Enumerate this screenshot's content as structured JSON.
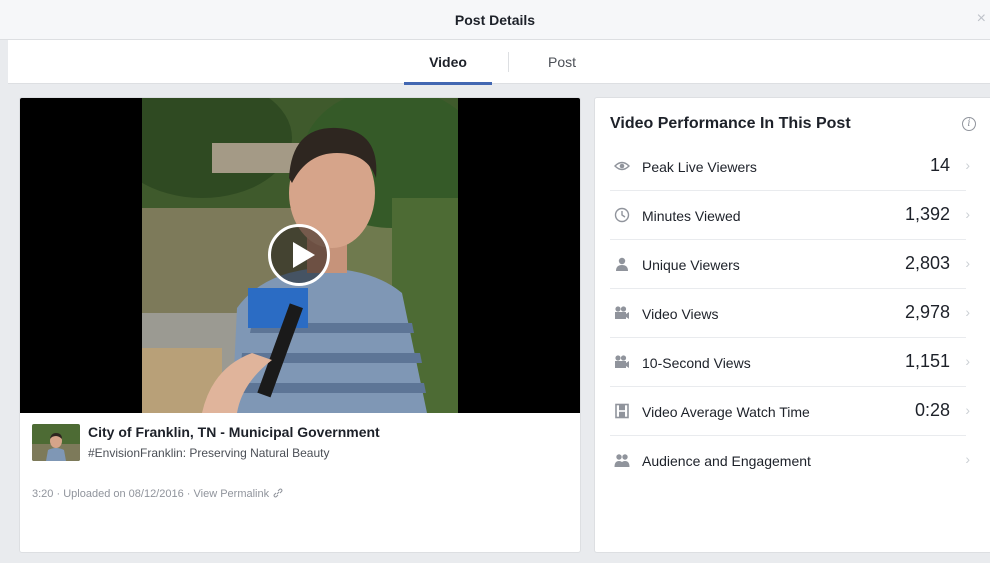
{
  "header": {
    "title": "Post Details",
    "close_label": "×"
  },
  "tabs": [
    {
      "label": "Video",
      "active": true
    },
    {
      "label": "Post",
      "active": false
    }
  ],
  "post": {
    "page_name": "City of Franklin, TN - Municipal Government",
    "caption": "#EnvisionFranklin: Preserving Natural Beauty",
    "duration": "3:20",
    "separator": "·",
    "uploaded": "Uploaded on 08/12/2016",
    "permalink": "View Permalink",
    "permalink_icon": "link-icon"
  },
  "performance": {
    "title": "Video Performance In This Post",
    "info_glyph": "i",
    "metrics": [
      {
        "label": "Peak Live Viewers",
        "value": "14",
        "icon": "eye-icon"
      },
      {
        "label": "Minutes Viewed",
        "value": "1,392",
        "icon": "clock-icon"
      },
      {
        "label": "Unique Viewers",
        "value": "2,803",
        "icon": "person-icon"
      },
      {
        "label": "Video Views",
        "value": "2,978",
        "icon": "video-camera-icon"
      },
      {
        "label": "10-Second Views",
        "value": "1,151",
        "icon": "video-camera-icon"
      },
      {
        "label": "Video Average Watch Time",
        "value": "0:28",
        "icon": "film-icon"
      },
      {
        "label": "Audience and Engagement",
        "value": "",
        "icon": "people-icon"
      }
    ],
    "chevron": "›"
  },
  "colors": {
    "accent": "#4267b2",
    "background": "#e9ebee",
    "icon_gray": "#90949c"
  }
}
